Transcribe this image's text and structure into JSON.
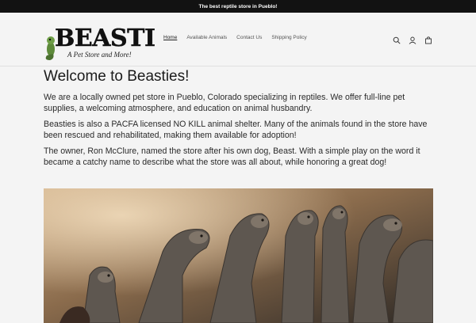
{
  "announcement": {
    "text": "The best reptile store in Pueblo!"
  },
  "header": {
    "logo_text": "BEASTIES",
    "logo_tagline": "A Pet Store and More!",
    "nav": [
      {
        "label": "Home",
        "active": true
      },
      {
        "label": "Available Animals",
        "active": false
      },
      {
        "label": "Contact Us",
        "active": false
      },
      {
        "label": "Shipping Policy",
        "active": false
      }
    ],
    "icons": [
      "search-icon",
      "account-icon",
      "cart-icon"
    ]
  },
  "main": {
    "title": "Welcome to Beasties!",
    "paragraphs": [
      "We are a locally owned pet store in Pueblo, Colorado specializing in reptiles. We offer full-line pet supplies, a welcoming atmosphere, and education on animal husbandry.",
      "Beasties is also a PACFA licensed NO KILL animal shelter. Many of the animals found in the store have been rescued and rehabilitated, making them available for adoption!",
      "The owner, Ron McClure, named the store after his own dog, Beast. With a simple play on the word it became a catchy name to describe what the store was all about, while honoring a great dog!"
    ],
    "hero_image": "bearded-dragons-photo"
  },
  "colors": {
    "announcement_bg": "#121212",
    "page_bg": "#f4f4f4",
    "text": "#1b1b1b"
  }
}
